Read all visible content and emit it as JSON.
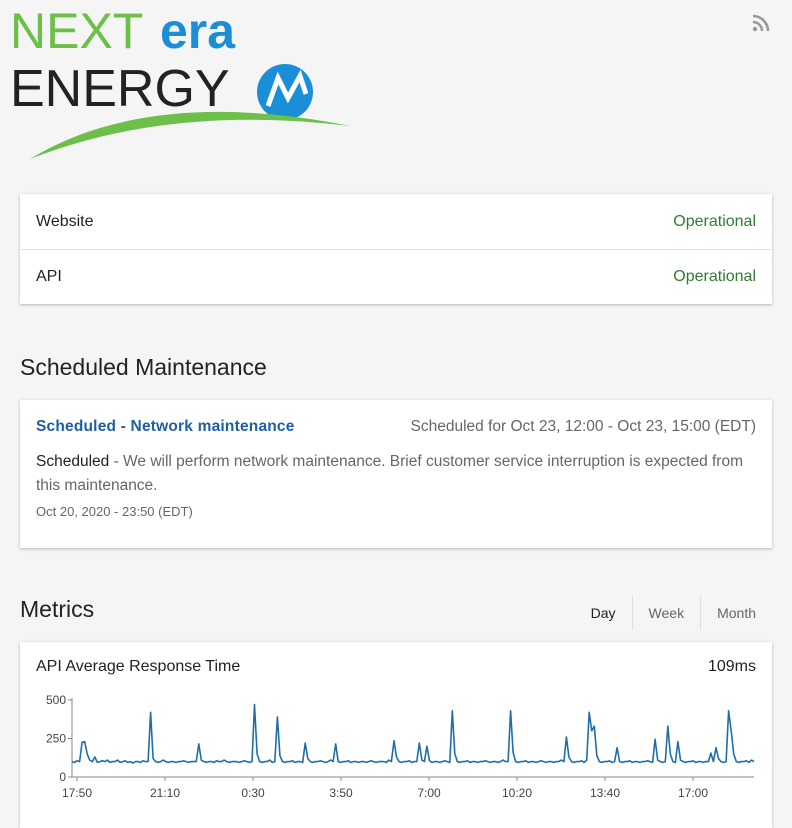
{
  "brand": {
    "line1_a": "NEXT",
    "line1_b": "era",
    "line2": "ENERGY",
    "colors": {
      "green": "#6cc04a",
      "blue": "#1a8fd8",
      "dark": "#222222"
    }
  },
  "header": {
    "feed_icon": "rss-icon"
  },
  "components": [
    {
      "name": "Website",
      "status": "Operational"
    },
    {
      "name": "API",
      "status": "Operational"
    }
  ],
  "colors": {
    "operational": "#2f7d32",
    "link": "#1d5fa3",
    "series": "#1f6ea8"
  },
  "maintenance": {
    "heading": "Scheduled Maintenance",
    "title": "Scheduled - Network maintenance",
    "scheduled_for": "Scheduled for Oct 23, 12:00 - Oct 23, 15:00 (EDT)",
    "status_label": "Scheduled",
    "message": " - We will perform network maintenance. Brief customer service interruption is expected from this maintenance.",
    "posted": "Oct 20, 2020 - 23:50 (EDT)"
  },
  "metrics": {
    "heading": "Metrics",
    "tabs": [
      "Day",
      "Week",
      "Month"
    ],
    "active_tab": "Day",
    "card_title": "API Average Response Time",
    "current_value": "109ms"
  },
  "chart_data": {
    "type": "line",
    "title": "API Average Response Time",
    "xlabel": "",
    "ylabel": "",
    "ylim": [
      0,
      500
    ],
    "yticks": [
      0,
      250,
      500
    ],
    "xticks": [
      "17:50",
      "21:10",
      "0:30",
      "3:50",
      "7:00",
      "10:20",
      "13:40",
      "17:00"
    ],
    "grid": false,
    "series": [
      {
        "name": "",
        "values": [
          100,
          95,
          105,
          100,
          225,
          230,
          150,
          110,
          100,
          130,
          95,
          100,
          105,
          100,
          110,
          95,
          100,
          100,
          110,
          95,
          100,
          105,
          95,
          100,
          90,
          100,
          100,
          95,
          105,
          100,
          100,
          420,
          120,
          100,
          95,
          100,
          110,
          100,
          95,
          100,
          100,
          95,
          100,
          100,
          105,
          100,
          95,
          100,
          100,
          100,
          215,
          110,
          100,
          95,
          100,
          100,
          95,
          105,
          100,
          100,
          110,
          100,
          95,
          100,
          100,
          100,
          95,
          100,
          105,
          100,
          95,
          100,
          470,
          150,
          100,
          95,
          100,
          100,
          110,
          95,
          100,
          390,
          140,
          100,
          95,
          100,
          100,
          105,
          95,
          100,
          100,
          95,
          220,
          120,
          100,
          95,
          100,
          100,
          105,
          100,
          95,
          100,
          110,
          100,
          215,
          100,
          95,
          100,
          100,
          105,
          95,
          100,
          100,
          95,
          100,
          100,
          95,
          100,
          105,
          100,
          95,
          100,
          100,
          100,
          95,
          110,
          100,
          235,
          130,
          100,
          95,
          100,
          100,
          105,
          95,
          100,
          100,
          220,
          110,
          100,
          200,
          105,
          95,
          100,
          100,
          95,
          100,
          105,
          100,
          95,
          430,
          150,
          100,
          95,
          100,
          100,
          105,
          95,
          100,
          100,
          95,
          100,
          100,
          105,
          100,
          95,
          100,
          100,
          95,
          100,
          110,
          100,
          100,
          430,
          160,
          100,
          95,
          100,
          100,
          105,
          95,
          100,
          100,
          95,
          100,
          105,
          100,
          95,
          100,
          100,
          95,
          100,
          100,
          110,
          100,
          260,
          130,
          100,
          95,
          100,
          100,
          105,
          95,
          110,
          420,
          300,
          330,
          140,
          100,
          95,
          100,
          100,
          105,
          95,
          100,
          190,
          100,
          95,
          100,
          100,
          105,
          95,
          100,
          100,
          95,
          100,
          100,
          105,
          100,
          95,
          245,
          110,
          100,
          95,
          100,
          330,
          150,
          100,
          95,
          230,
          110,
          100,
          95,
          100,
          100,
          105,
          95,
          100,
          100,
          95,
          100,
          100,
          155,
          100,
          190,
          120,
          100,
          95,
          100,
          430,
          300,
          150,
          100,
          95,
          100,
          100,
          105,
          95,
          110,
          100
        ]
      }
    ]
  }
}
